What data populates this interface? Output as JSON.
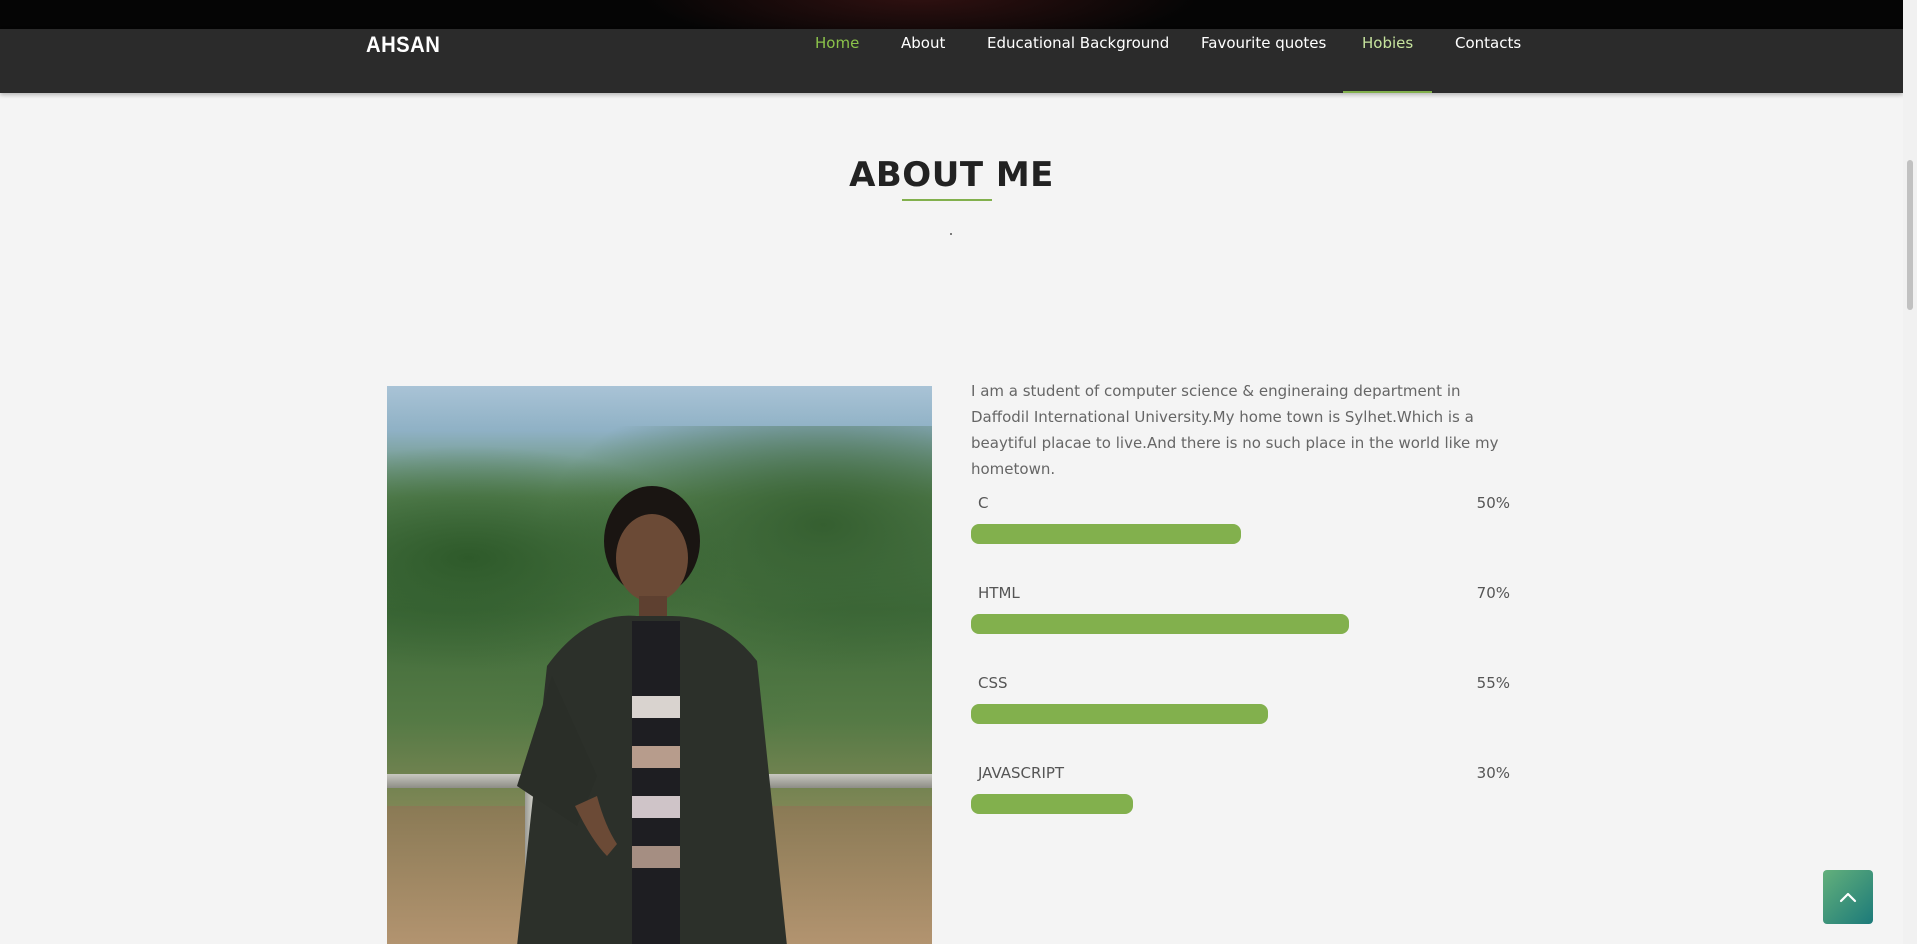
{
  "brand": {
    "logo": "AHSAN"
  },
  "nav": {
    "items": [
      {
        "label": "Home",
        "state": "active"
      },
      {
        "label": "About",
        "state": "normal"
      },
      {
        "label": "Educational Background",
        "state": "normal"
      },
      {
        "label": "Favourite quotes",
        "state": "normal"
      },
      {
        "label": "Hobies",
        "state": "hover"
      },
      {
        "label": "Contacts",
        "state": "normal"
      }
    ]
  },
  "section": {
    "title": "ABOUT ME",
    "subtitle": "."
  },
  "about": {
    "text": "I am a student of computer science & engineraing department in Daffodil International University.My home town is Sylhet.Which is a beaytiful placae to live.And there is no such place in the world like my hometown."
  },
  "skills": [
    {
      "name": "C",
      "percent_label": "50%",
      "level": 0.5
    },
    {
      "name": "HTML",
      "percent_label": "70%",
      "level": 0.7
    },
    {
      "name": "CSS",
      "percent_label": "55%",
      "level": 0.55
    },
    {
      "name": "JAVASCRIPT",
      "percent_label": "30%",
      "level": 0.3
    }
  ],
  "colors": {
    "accent": "#82b04d",
    "nav_active": "#8bc34a",
    "navbar_bg": "#2b2b2b",
    "page_bg": "#f4f4f4",
    "back_to_top_gradient": [
      "#63b07b",
      "#1c7a7a"
    ]
  },
  "icons": {
    "back_to_top": "chevron-up-icon"
  }
}
